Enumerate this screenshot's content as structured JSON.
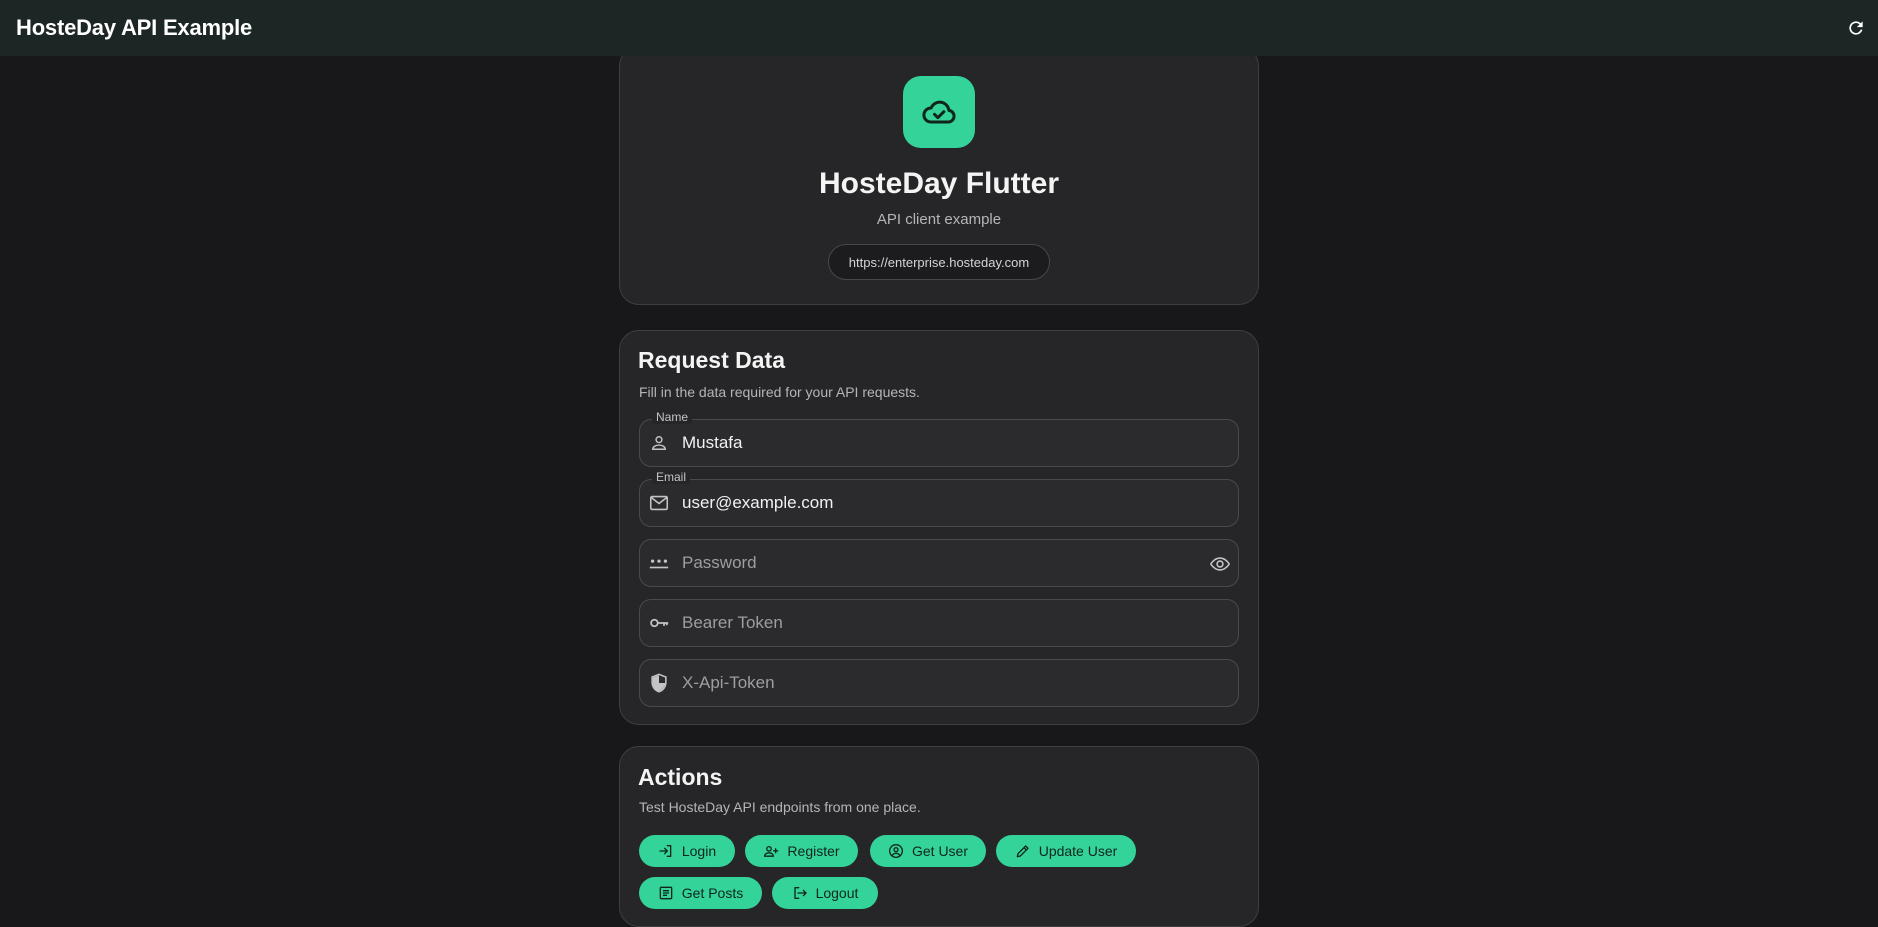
{
  "appbar": {
    "title": "HosteDay API Example",
    "refresh_icon": "refresh-icon"
  },
  "hero": {
    "logo_icon": "cloud-done-icon",
    "title": "HosteDay Flutter",
    "subtitle": "API client example",
    "base_url": "https://enterprise.hosteday.com"
  },
  "request": {
    "title": "Request Data",
    "description": "Fill in the data required for your API requests.",
    "fields": {
      "name": {
        "label": "Name",
        "value": "Mustafa",
        "icon": "person-icon"
      },
      "email": {
        "label": "Email",
        "value": "user@example.com",
        "icon": "mail-icon"
      },
      "password": {
        "placeholder": "Password",
        "value": "",
        "icon": "password-icon",
        "trailing_icon": "eye-icon"
      },
      "bearer": {
        "placeholder": "Bearer Token",
        "value": "",
        "icon": "key-icon"
      },
      "xapi": {
        "placeholder": "X-Api-Token",
        "value": "",
        "icon": "shield-icon"
      }
    }
  },
  "actions": {
    "title": "Actions",
    "description": "Test HosteDay API endpoints from one place.",
    "buttons": {
      "login": {
        "label": "Login",
        "icon": "login-icon"
      },
      "register": {
        "label": "Register",
        "icon": "person-add-icon"
      },
      "get_user": {
        "label": "Get User",
        "icon": "account-circle-icon"
      },
      "update_user": {
        "label": "Update User",
        "icon": "edit-icon"
      },
      "get_posts": {
        "label": "Get Posts",
        "icon": "article-icon"
      },
      "logout": {
        "label": "Logout",
        "icon": "logout-icon"
      }
    }
  },
  "colors": {
    "accent": "#34d399",
    "background": "#18181a",
    "card": "#262628",
    "appbar": "#1c2624"
  }
}
